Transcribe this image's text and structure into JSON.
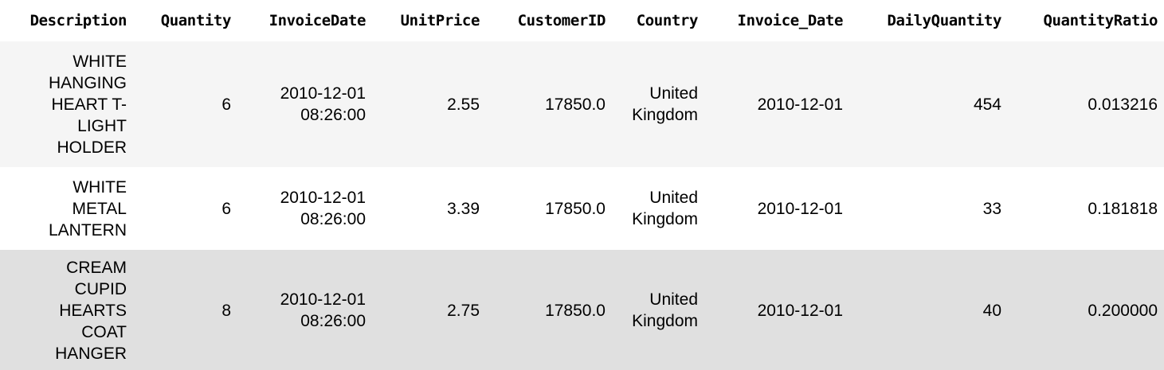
{
  "columns": [
    "Description",
    "Quantity",
    "InvoiceDate",
    "UnitPrice",
    "CustomerID",
    "Country",
    "Invoice_Date",
    "DailyQuantity",
    "QuantityRatio"
  ],
  "rows": [
    {
      "description": [
        "WHITE",
        "HANGING",
        "HEART T-",
        "LIGHT",
        "HOLDER"
      ],
      "quantity": "6",
      "invoice_date": [
        "2010-12-01",
        "08:26:00"
      ],
      "unit_price": "2.55",
      "customer_id": "17850.0",
      "country": [
        "United",
        "Kingdom"
      ],
      "invoice_date_short": "2010-12-01",
      "daily_quantity": "454",
      "quantity_ratio": "0.013216"
    },
    {
      "description": [
        "WHITE",
        "METAL",
        "LANTERN"
      ],
      "quantity": "6",
      "invoice_date": [
        "2010-12-01",
        "08:26:00"
      ],
      "unit_price": "3.39",
      "customer_id": "17850.0",
      "country": [
        "United",
        "Kingdom"
      ],
      "invoice_date_short": "2010-12-01",
      "daily_quantity": "33",
      "quantity_ratio": "0.181818"
    },
    {
      "description": [
        "CREAM",
        "CUPID",
        "HEARTS",
        "COAT",
        "HANGER"
      ],
      "quantity": "8",
      "invoice_date": [
        "2010-12-01",
        "08:26:00"
      ],
      "unit_price": "2.75",
      "customer_id": "17850.0",
      "country": [
        "United",
        "Kingdom"
      ],
      "invoice_date_short": "2010-12-01",
      "daily_quantity": "40",
      "quantity_ratio": "0.200000"
    }
  ]
}
